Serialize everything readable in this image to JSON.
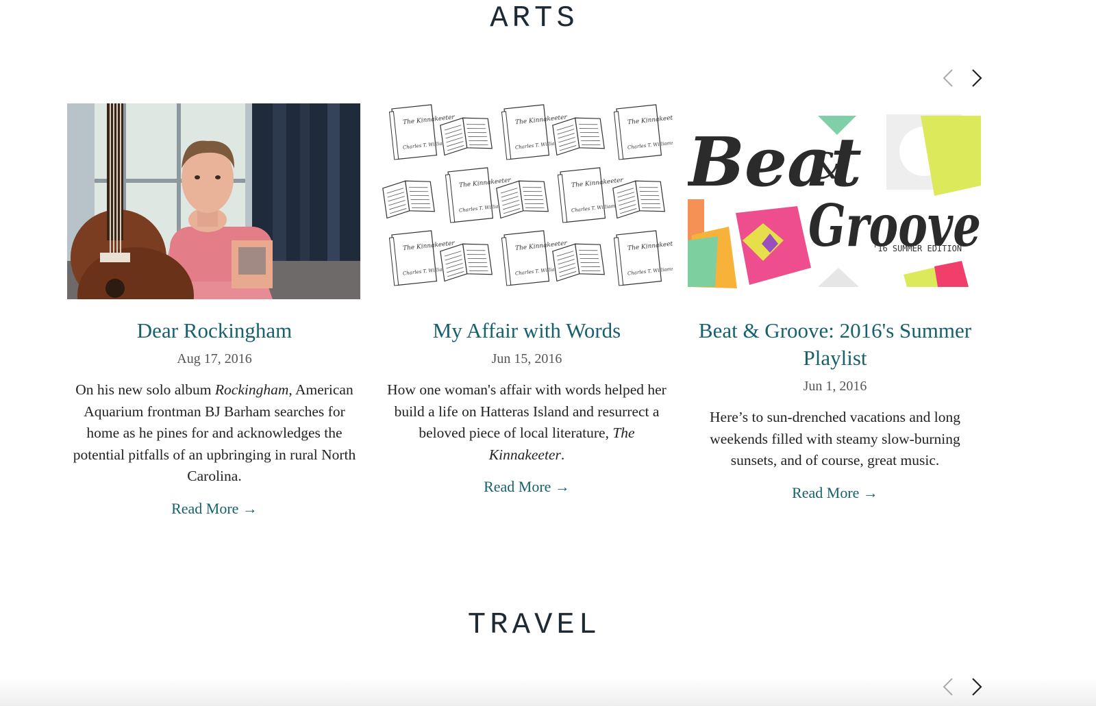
{
  "sections": {
    "arts": {
      "title": "ARTS"
    },
    "travel": {
      "title": "TRAVEL"
    }
  },
  "cards": [
    {
      "title": "Dear Rockingham",
      "date": "Aug 17, 2016",
      "desc_parts": [
        "On his new solo album ",
        "Rockingham",
        ", American Aquarium frontman BJ Barham searches for home as he pines for and acknowledges the potential pitfalls of an upbringing in rural North Carolina."
      ],
      "read_more": "Read More →"
    },
    {
      "title": "My Affair with Words",
      "date": "Jun 15, 2016",
      "desc_parts": [
        "How one woman's affair with words helped her build a life on Hatteras Island and resurrect a beloved piece of local literature, ",
        "The Kinnakeeter",
        "."
      ],
      "read_more": "Read More →",
      "image_text": {
        "book_title": "The Kinnakeeter",
        "book_author": "Charles T. Williams II"
      }
    },
    {
      "title": "Beat & Groove: 2016's Summer Playlist",
      "date": "Jun 1, 2016",
      "desc_parts": [
        "Here’s to sun-drenched vacations and long weekends filled with steamy slow-burning sunsets, and of course, great music."
      ],
      "read_more": "Read More →",
      "image_text": {
        "beat": "Beat",
        "amp": "&",
        "groove": "Groove",
        "edition": "'16 SUMMER EDITION"
      }
    }
  ],
  "icons": {
    "prev": "chevron-left-icon",
    "next": "chevron-right-icon"
  },
  "colors": {
    "link": "#17606d",
    "heading": "#1e2a33",
    "text": "#222222",
    "date": "#555555"
  }
}
